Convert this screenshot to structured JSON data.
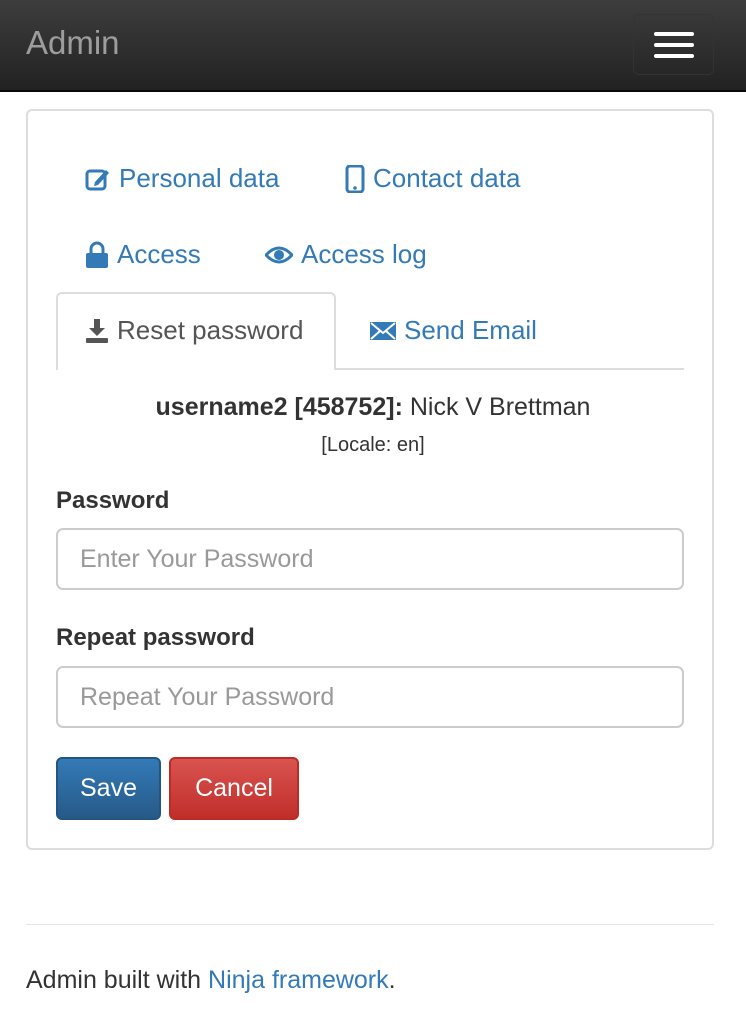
{
  "navbar": {
    "brand": "Admin",
    "menu_icon": "hamburger-menu-icon"
  },
  "tabs": {
    "personal_data": {
      "label": "Personal data",
      "icon": "edit-icon"
    },
    "contact_data": {
      "label": "Contact data",
      "icon": "mobile-phone-icon"
    },
    "access": {
      "label": "Access",
      "icon": "lock-icon"
    },
    "access_log": {
      "label": "Access log",
      "icon": "eye-icon"
    },
    "reset_password": {
      "label": "Reset password",
      "icon": "download-icon",
      "active": true
    },
    "send_email": {
      "label": "Send Email",
      "icon": "envelope-icon"
    }
  },
  "user": {
    "id_label": "username2 [458752]:",
    "name": "Nick V Brettman",
    "locale": "[Locale: en]"
  },
  "form": {
    "password_label": "Password",
    "password_placeholder": "Enter Your Password",
    "password_value": "",
    "repeat_label": "Repeat password",
    "repeat_placeholder": "Repeat Your Password",
    "repeat_value": "",
    "save_label": "Save",
    "cancel_label": "Cancel"
  },
  "footer": {
    "text": "Admin built with ",
    "link_text": "Ninja framework",
    "suffix": "."
  },
  "colors": {
    "link": "#337ab7",
    "primary": "#337ab7",
    "danger": "#d9534f",
    "navbar": "#222222"
  }
}
